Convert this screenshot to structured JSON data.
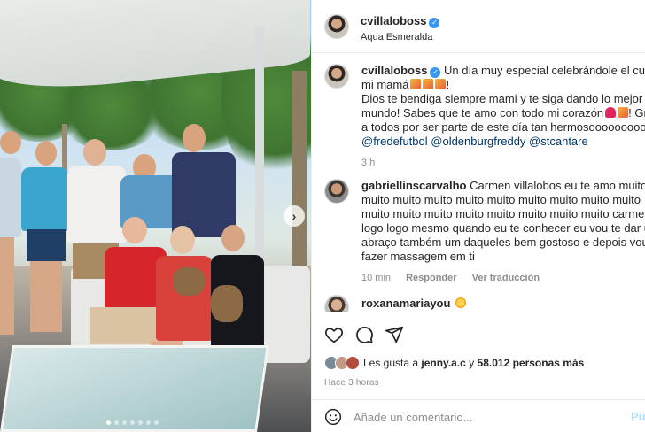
{
  "post": {
    "author": "cvillaloboss",
    "location": "Aqua Esmeralda"
  },
  "caption": {
    "author": "cvillaloboss",
    "line1": "Un día muy especial celebrándole el cumple a",
    "line2": "mi mamá",
    "line3": "Dios te bendiga siempre mami y te siga dando lo mejor del",
    "line4": "mundo! Sabes que te amo con todo mi corazón",
    "line4b": "! Gracias",
    "line5": "a todos por ser parte de este día tan hermosoooooooooo",
    "tags": [
      "@fredefutbol",
      "@oldenburgfreddy",
      "@stcantare"
    ],
    "time": "3 h"
  },
  "comments": [
    {
      "author": "gabriellinscarvalho",
      "text1": "Carmen villalobos eu te amo muito",
      "text2": "muito muito muito muito muito muito muito muito muito",
      "text3": "muito muito muito muito muito muito muito muito carmen",
      "text4": "logo logo mesmo quando eu te conhecer eu vou te dar um",
      "text5": "abraço também um daqueles bem gostoso e depois vou",
      "text6": "fazer massagem em ti",
      "time": "10 min",
      "reply": "Responder",
      "translate": "Ver traducción"
    },
    {
      "author": "roxanamariayou"
    }
  ],
  "actions": {
    "like_icon": "heart-icon",
    "comment_icon": "comment-icon",
    "share_icon": "send-icon"
  },
  "likes": {
    "prefix": "Les gusta a",
    "first_user": "jenny.a.c",
    "connector": "y",
    "count": "58.012 personas más"
  },
  "posted_ago": "Hace 3 horas",
  "add_comment": {
    "placeholder": "Añade un comentario...",
    "publish": "Publicar"
  },
  "colors": {
    "verified": "#3897f0",
    "muted": "#8e8e8e",
    "tag": "#00376b",
    "publish": "#b2dffc"
  },
  "carousel": {
    "total": 7,
    "active": 1
  }
}
